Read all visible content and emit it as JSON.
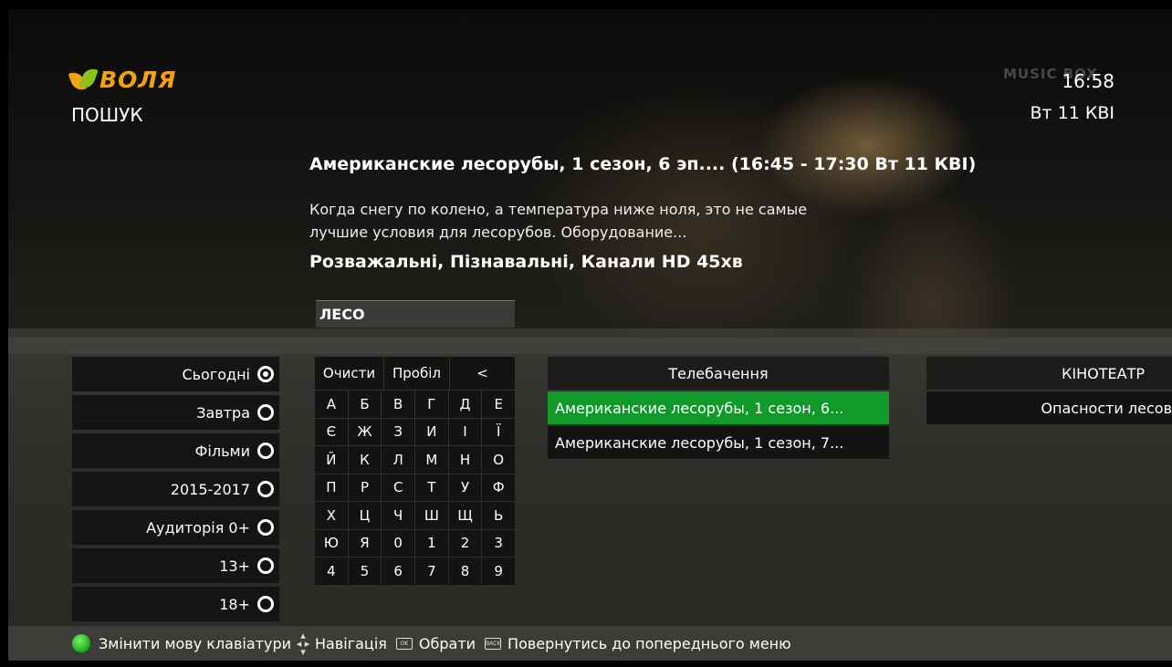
{
  "header": {
    "logo_text": "ВОЛЯ",
    "page_title": "ПОШУК",
    "time": "16:58",
    "date": "Вт 11 КВІ",
    "channel_watermark": "MUSIC BOX"
  },
  "program": {
    "title": "Американские лесорубы, 1 сезон, 6 эп.... (16:45 - 17:30 Вт 11 КВІ)",
    "description": "Когда снегу по колено, а температура ниже ноля, это не самые лучшие условия для лесорубов. Оборудование...",
    "genre": "Розважальні, Пізнавальні, Канали HD  45хв"
  },
  "search": {
    "query": "ЛЕСО"
  },
  "filters": [
    {
      "label": "Сьогодні",
      "selected": true
    },
    {
      "label": "Завтра",
      "selected": false
    },
    {
      "label": "Фільми",
      "selected": false
    },
    {
      "label": "2015-2017",
      "selected": false
    },
    {
      "label": "Аудиторія 0+",
      "selected": false
    },
    {
      "label": "13+",
      "selected": false
    },
    {
      "label": "18+",
      "selected": false
    }
  ],
  "keyboard": {
    "clear": "Очисти",
    "space": "Пробіл",
    "backspace": "<",
    "rows": [
      [
        "А",
        "Б",
        "В",
        "Г",
        "Д",
        "Е"
      ],
      [
        "Є",
        "Ж",
        "З",
        "И",
        "І",
        "Ї"
      ],
      [
        "Й",
        "К",
        "Л",
        "М",
        "Н",
        "О"
      ],
      [
        "П",
        "Р",
        "С",
        "Т",
        "У",
        "Ф"
      ],
      [
        "Х",
        "Ц",
        "Ч",
        "Ш",
        "Щ",
        "Ь"
      ],
      [
        "Ю",
        "Я",
        "0",
        "1",
        "2",
        "3"
      ],
      [
        "4",
        "5",
        "6",
        "7",
        "8",
        "9"
      ]
    ]
  },
  "results": {
    "tv_header": "Телебачення",
    "tv_items": [
      "Американские лесорубы, 1 сезон, 6...",
      "Американские лесорубы, 1 сезон, 7..."
    ],
    "cinema_header": "КІНОТЕАТР",
    "cinema_items": [
      "Опасности лесов"
    ]
  },
  "footer": {
    "change_lang": "Змінити мову клавіатури",
    "navigation": "Навігація",
    "select": "Обрати",
    "back": "Повернутись до попереднього меню",
    "ok_key": "OK",
    "back_key": "BACK"
  },
  "colors": {
    "highlight": "#0f9a2a",
    "brand_orange": "#f2a20c",
    "brand_green": "#8bc21a"
  }
}
